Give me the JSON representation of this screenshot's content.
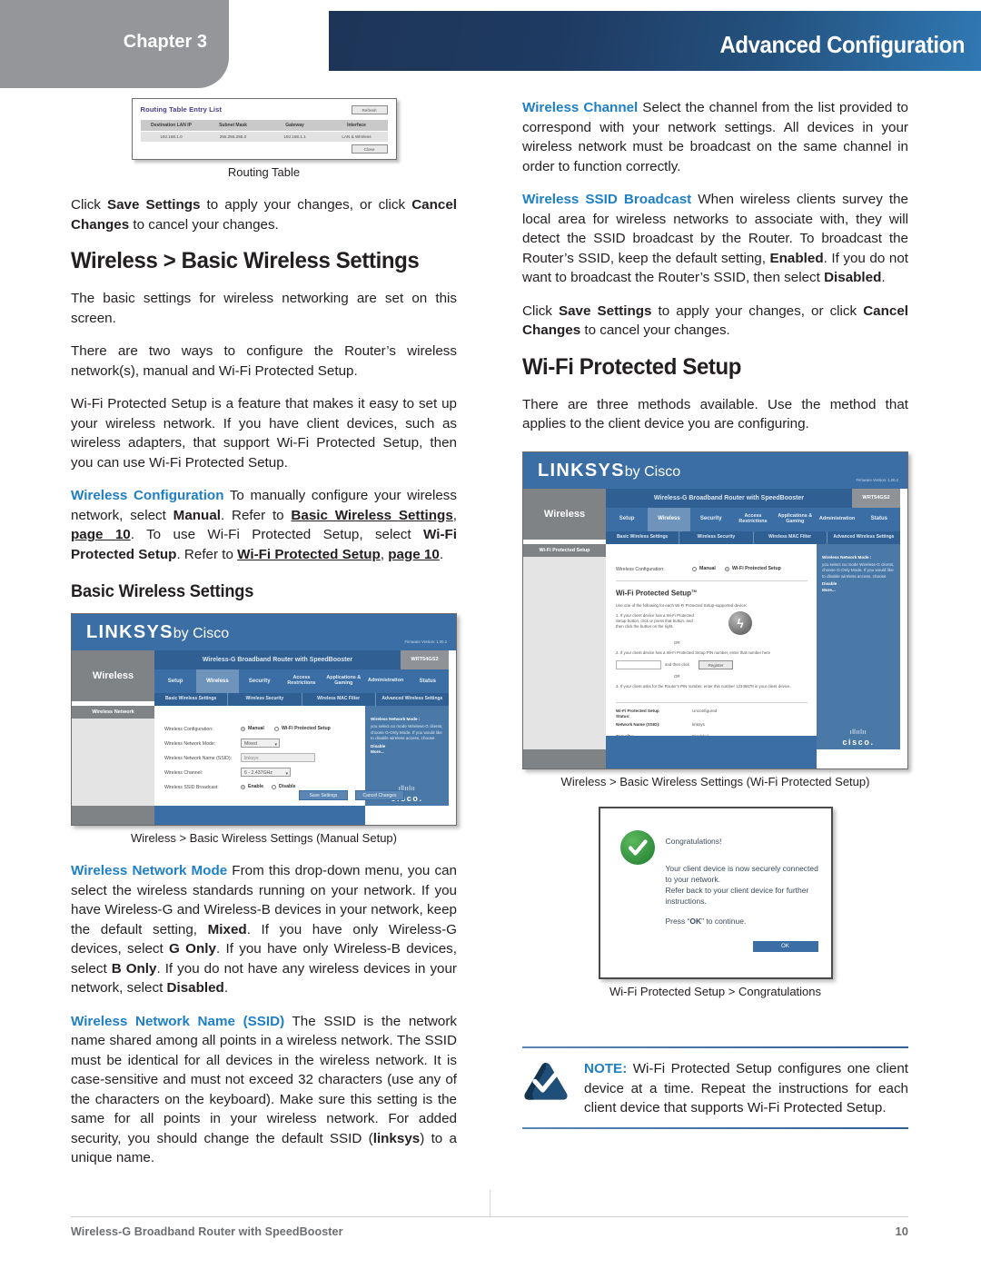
{
  "header": {
    "chapter_label": "Chapter 3",
    "title": "Advanced Configuration",
    "band_gradient_start": "#1d3557",
    "band_gradient_end": "#3079b4",
    "chapter_tab_color": "#949699"
  },
  "left_column": {
    "routing_figure": {
      "title": "Routing Table Entry List",
      "refresh_label": "Refresh",
      "close_label": "Close",
      "columns": [
        "Destination LAN IP",
        "Subnet Mask",
        "Gateway",
        "Interface"
      ],
      "rows": [
        [
          "192.168.1.0",
          "255.255.255.0",
          "192.168.1.1",
          "LAN & Wireless"
        ]
      ],
      "caption": "Routing Table"
    },
    "para_save": {
      "t1": "Click ",
      "b1": "Save Settings",
      "t2": " to apply your changes, or click ",
      "b2": "Cancel Changes",
      "t3": " to cancel your changes."
    },
    "section_title": "Wireless > Basic Wireless Settings",
    "para_basic": "The basic settings for wireless networking are set on this screen.",
    "para_twoways": "There are two ways to configure the Router’s wireless network(s), manual and Wi-Fi Protected Setup.",
    "para_wps_intro": "Wi-Fi Protected Setup is a feature that makes it easy to set up your wireless network. If you have client devices, such as wireless adapters, that support Wi-Fi Protected Setup, then you can use Wi-Fi Protected Setup.",
    "para_wireless_config": {
      "label": "Wireless Configuration",
      "t1": " To manually configure your wireless network, select ",
      "b1": "Manual",
      "t2": ". Refer to ",
      "u1": "Basic Wireless Settings",
      "t3": ", ",
      "u2": "page 10",
      "t4": ". To use Wi-Fi Protected Setup, select ",
      "b2": "Wi-Fi Protected Setup",
      "t5": ". Refer to ",
      "u3": "Wi-Fi Protected Setup",
      "t6": ", ",
      "u4": "page 10",
      "t7": "."
    },
    "subsection_title": "Basic Wireless Settings",
    "manual_figure": {
      "logo": "LINKSYS",
      "logo_suffix": "by Cisco",
      "firmware": "Firmware Version: 1.00.2",
      "product_bar": "Wireless-G Broadband Router with SpeedBooster",
      "model": "WRT54GS2",
      "side_title": "Wireless",
      "tabs": [
        "Setup",
        "Wireless",
        "Security",
        "Access Restrictions",
        "Applications & Gaming",
        "Administration",
        "Status"
      ],
      "active_tab": "Wireless",
      "subtabs": [
        "Basic Wireless Settings",
        "Wireless Security",
        "Wireless MAC Filter",
        "Advanced Wireless Settings"
      ],
      "panel_title": "Wireless Network",
      "fields": [
        {
          "label": "Wireless Configuration:",
          "type": "radio",
          "options": [
            "Manual",
            "Wi-Fi Protected Setup"
          ],
          "selected": "Manual"
        },
        {
          "label": "Wireless Network Mode:",
          "type": "select",
          "value": "Mixed"
        },
        {
          "label": "Wireless Network Name (SSID):",
          "type": "text",
          "value": "linksys"
        },
        {
          "label": "Wireless Channel:",
          "type": "select",
          "value": "6 - 2.437GHz"
        },
        {
          "label": "Wireless SSID Broadcast:",
          "type": "radio",
          "options": [
            "Enable",
            "Disable"
          ],
          "selected": "Enable"
        }
      ],
      "help_title": "Wireless Network Mode :",
      "help_body": "you select no mode Wireless-G clients, choose G-Only Mode. If you would like to disable wireless access, choose",
      "help_bold1": "Disable",
      "help_more": "More...",
      "buttons": [
        "Save Settings",
        "Cancel Changes"
      ],
      "cisco_logo": "cisco",
      "caption": "Wireless > Basic Wireless Settings (Manual Setup)"
    },
    "para_network_mode": {
      "label": "Wireless Network Mode",
      "t1": " From this drop-down menu, you can select the wireless standards running on your network. If you have Wireless-G and Wireless-B devices in your network, keep the default setting, ",
      "b1": "Mixed",
      "t2": ". If you have only Wireless-G devices, select ",
      "b2": "G Only",
      "t3": ". If you have only Wireless-B devices, select ",
      "b3": "B Only",
      "t4": ". If you do not have any wireless devices in your network, select ",
      "b4": "Disabled",
      "t5": "."
    },
    "para_ssid": {
      "label": "Wireless Network Name (SSID)",
      "t1": "  The SSID is the network name shared among all points in a wireless network. The SSID must be identical for all devices in the wireless network. It is case-sensitive and must not exceed 32 characters (use any of the characters on the keyboard). Make sure this setting is the same for all points in your wireless network. For added security, you should change the default SSID (",
      "b1": "linksys",
      "t2": ") to a unique name."
    }
  },
  "right_column": {
    "para_channel": {
      "label": "Wireless Channel",
      "t1": " Select the channel from the list provided to correspond with your network settings. All devices in your wireless network must be broadcast on the same channel in order to function correctly."
    },
    "para_ssid_broadcast": {
      "label": "Wireless SSID Broadcast",
      "t1": " When wireless clients survey the local area for wireless networks to associate with, they will detect the SSID broadcast by the Router. To broadcast the Router’s SSID, keep the default setting, ",
      "b1": "Enabled",
      "t2": ". If you do not want to broadcast the Router’s SSID, then select ",
      "b2": "Disabled",
      "t3": "."
    },
    "para_save": {
      "t1": "Click ",
      "b1": "Save Settings",
      "t2": " to apply your changes, or click ",
      "b2": "Cancel Changes",
      "t3": " to cancel your changes."
    },
    "section_title": "Wi-Fi Protected Setup",
    "para_methods": "There are three methods available. Use the method that applies to the client device you are configuring.",
    "wps_figure": {
      "logo": "LINKSYS",
      "logo_suffix": "by Cisco",
      "firmware": "Firmware Version: 1.00.2",
      "product_bar": "Wireless-G Broadband Router with SpeedBooster",
      "model": "WRT54GS2",
      "side_title": "Wireless",
      "tabs": [
        "Setup",
        "Wireless",
        "Security",
        "Access Restrictions",
        "Applications & Gaming",
        "Administration",
        "Status"
      ],
      "active_tab": "Wireless",
      "subtabs": [
        "Basic Wireless Settings",
        "Wireless Security",
        "Wireless MAC Filter",
        "Advanced Wireless Settings"
      ],
      "panel_title": "Wi-Fi Protected Setup",
      "config_label": "Wireless Configuration:",
      "config_options": [
        "Manual",
        "Wi-Fi Protected Setup"
      ],
      "config_selected": "Wi-Fi Protected Setup",
      "wps_heading": "Wi-Fi Protected Setup",
      "wps_heading_tm": "TM",
      "wps_intro": "Use one of the following for each Wi-Fi Protected Setup-supported device:",
      "step1": "1. If your client device has a Wi-Fi Protected Setup button, click or press that button, and then click the button on the right.",
      "or1": "OR",
      "step2": "2. If your client device has a Wi-Fi Protected Setup PIN number, enter that number here",
      "step2_suffix": "and then click",
      "register_btn": "Register",
      "or2": "OR",
      "step3": "3. If your client asks for the Router's PIN number, enter this number 12345678 in your client device.",
      "status_rows": [
        {
          "label": "Wi-Fi Protected Setup Status:",
          "value": "Unconfigured"
        },
        {
          "label": "Network Name (SSID):",
          "value": "linksys"
        },
        {
          "label": "Security:",
          "value": "Disabled"
        }
      ],
      "help_title": "Wireless Network Mode :",
      "help_body": "you select no mode Wireless-G clients, choose G-Only Mode. If you would like to disable wireless access, choose",
      "help_bold1": "Disable",
      "help_more": "More...",
      "cisco_logo": "cisco",
      "caption": "Wireless > Basic Wireless Settings (Wi-Fi Protected Setup)"
    },
    "congrats_figure": {
      "title": "Congratulations!",
      "line1": "Your client device is now securely connected to your network.",
      "line2": "Refer back to your client device for further instructions.",
      "line3_pre": "Press “",
      "line3_bold": "OK",
      "line3_post": "” to continue.",
      "ok_label": "OK",
      "caption": "Wi-Fi Protected Setup > Congratulations"
    },
    "note": {
      "label": "NOTE:",
      "text": " Wi-Fi Protected Setup configures one client device at a time. Repeat the instructions for each client device that supports Wi-Fi Protected Setup.",
      "icon_color": "#1f4e79"
    }
  },
  "footer": {
    "left": "Wireless-G Broadband Router with SpeedBooster",
    "page_number": "10"
  }
}
